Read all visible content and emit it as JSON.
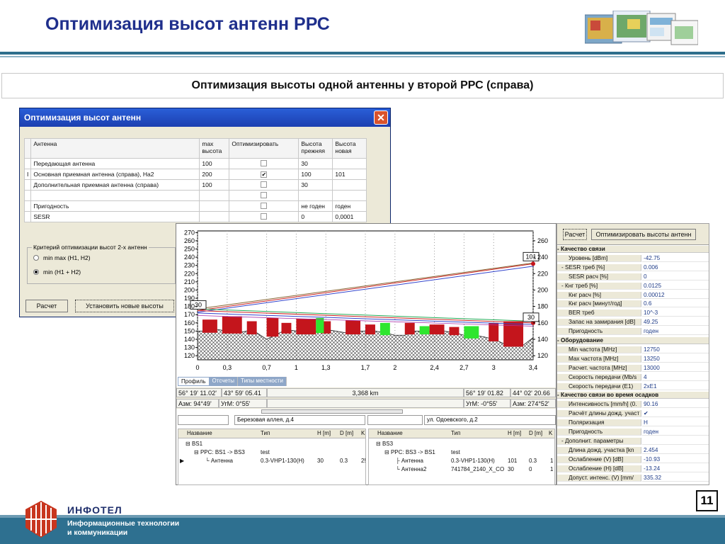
{
  "slide": {
    "title": "Оптимизация высот антенн РРС",
    "subtitle": "Оптимизация высоты одной антенны у второй РРС (справа)",
    "page_number": "11",
    "brand": "ИНФОТЕЛ",
    "tagline_1": "Информационные технологии",
    "tagline_2": "и коммуникации"
  },
  "dialog": {
    "title": "Оптимизация высот антенн",
    "close_icon": "close-icon",
    "headers": {
      "antenna": "Антенна",
      "max_height_1": "max",
      "max_height_2": "высота",
      "optimize": "Оптимизировать",
      "prev_1": "Высота",
      "prev_2": "прежняя",
      "new_1": "Высота",
      "new_2": "новая"
    },
    "rows": [
      {
        "marker": "",
        "name": "Передающая антенна",
        "max": "100",
        "checked": "",
        "prev": "30",
        "new": ""
      },
      {
        "marker": "I",
        "name": "Основная приемная антенна (справа), На2",
        "max": "200",
        "checked": "✔",
        "prev": "100",
        "new": "101"
      },
      {
        "marker": "",
        "name": "Дополнительная приемная антенна (справа)",
        "max": "100",
        "checked": "",
        "prev": "30",
        "new": ""
      },
      {
        "marker": "",
        "name": "",
        "max": "",
        "checked": "",
        "prev": "",
        "new": ""
      },
      {
        "marker": "",
        "name": "Пригодность",
        "max": "",
        "checked": "",
        "prev": "не годен",
        "new": "годен"
      },
      {
        "marker": "",
        "name": "SESR",
        "max": "",
        "checked": "",
        "prev": "0",
        "new": "0,0001"
      }
    ],
    "criterion_legend": "Критерий оптимизации высот 2-х антенн",
    "option_1": "min max (H1, H2)",
    "option_2": "min (H1 + H2)",
    "calc_button": "Расчет",
    "apply_button": "Установить новые высоты"
  },
  "profile": {
    "tabs": [
      "Профиль",
      "Отсчеты",
      "Типы местности"
    ],
    "left_coord": "56° 19' 11.02'",
    "left_coord_2": "43° 59' 05.41",
    "distance": "3,368 km",
    "right_coord": "56° 19' 01.82",
    "right_coord_2": "44° 02' 20.66",
    "az_left": "Азм: 94°49'",
    "ug_left": "УгМ: 0°55'",
    "ug_right": "УгМ: -0°55'",
    "az_right": "Азм: 274°52'",
    "site_left": "Березовая аллея, д.4",
    "site_right": "ул. Одоевского, д.2",
    "tree_headers": {
      "name": "Название",
      "type": "Тип",
      "h": "H [m]",
      "d": "D [m]",
      "k": "K"
    },
    "tree_left": [
      {
        "name": "BS1",
        "type": "",
        "h": "",
        "d": "",
        "k": ""
      },
      {
        "name": "PPC: BS1 -> BS3",
        "type": "test",
        "h": "",
        "d": "",
        "k": ""
      },
      {
        "name": "Антенна",
        "type": "0.3-VHP1-130(H)",
        "h": "30",
        "d": "0.3",
        "k": "2!"
      }
    ],
    "tree_right": [
      {
        "name": "BS3",
        "type": "",
        "h": "",
        "d": "",
        "k": ""
      },
      {
        "name": "PPC: BS3 -> BS1",
        "type": "test",
        "h": "",
        "d": "",
        "k": ""
      },
      {
        "name": "Антенна",
        "type": "0.3-VHP1-130(H)",
        "h": "101",
        "d": "0.3",
        "k": "1"
      },
      {
        "name": "Антенна2",
        "type": "741784_2140_X_CO",
        "h": "30",
        "d": "0",
        "k": "1"
      }
    ]
  },
  "chart_data": {
    "type": "line",
    "x_ticks": [
      "0",
      "0,3",
      "0,7",
      "1",
      "1,3",
      "1,7",
      "2",
      "2,4",
      "2,7",
      "3",
      "3,4"
    ],
    "y_left_ticks": [
      "270",
      "260",
      "250",
      "240",
      "230",
      "220",
      "210",
      "200",
      "190",
      "180",
      "170",
      "160",
      "150",
      "140",
      "130",
      "120"
    ],
    "y_right_ticks": [
      "260",
      "240",
      "220",
      "200",
      "180",
      "160",
      "140",
      "120"
    ],
    "xlim": [
      0,
      3.4
    ],
    "ylim": [
      115,
      272
    ],
    "antenna_labels": {
      "left": "30",
      "right_main": "101",
      "right_second": "30"
    },
    "left_tx_height": 175,
    "right_main_height": 232,
    "right_second_height": 160,
    "terrain_x": [
      0,
      0.1,
      0.2,
      0.3,
      0.4,
      0.5,
      0.6,
      0.7,
      0.8,
      0.9,
      1.0,
      1.1,
      1.2,
      1.3,
      1.4,
      1.5,
      1.6,
      1.7,
      1.8,
      1.9,
      2.0,
      2.1,
      2.2,
      2.3,
      2.4,
      2.5,
      2.6,
      2.7,
      2.8,
      2.9,
      3.0,
      3.1,
      3.2,
      3.3,
      3.4
    ],
    "terrain_y": [
      150,
      150,
      152,
      150,
      148,
      150,
      148,
      140,
      146,
      152,
      150,
      150,
      150,
      152,
      150,
      148,
      150,
      150,
      150,
      148,
      145,
      145,
      150,
      150,
      150,
      150,
      148,
      145,
      145,
      143,
      140,
      135,
      132,
      133,
      142
    ],
    "veg_red": [
      [
        0.05,
        0.2,
        164
      ],
      [
        0.25,
        0.45,
        168
      ],
      [
        0.5,
        0.6,
        162
      ],
      [
        0.7,
        0.82,
        166
      ],
      [
        0.85,
        0.95,
        160
      ],
      [
        1.0,
        1.2,
        165
      ],
      [
        1.25,
        1.35,
        162
      ],
      [
        1.5,
        1.65,
        163
      ],
      [
        1.7,
        1.8,
        158
      ],
      [
        2.1,
        2.2,
        160
      ],
      [
        2.35,
        2.5,
        158
      ],
      [
        2.55,
        2.65,
        155
      ],
      [
        2.95,
        3.05,
        160
      ],
      [
        3.1,
        3.3,
        162
      ]
    ],
    "veg_green": [
      [
        1.2,
        1.28,
        166
      ],
      [
        1.85,
        1.95,
        160
      ],
      [
        2.25,
        2.35,
        156
      ],
      [
        2.7,
        2.85,
        156
      ]
    ]
  },
  "props": {
    "calc_button": "Расчет",
    "optimize_button": "Оптимизировать высоты антенн",
    "rows": [
      {
        "h": "- Качество связи"
      },
      {
        "k": "Уровень [dBm]",
        "v": "-42.75"
      },
      {
        "k": "- SESR треб [%]",
        "v": "0.006"
      },
      {
        "k": "SESR расч [%]",
        "v": "0"
      },
      {
        "k": "- Кнг треб [%]",
        "v": "0.0125"
      },
      {
        "k": "Кнг расч [%]",
        "v": "0.00012"
      },
      {
        "k": "Кнг расч [минут/год]",
        "v": "0.6"
      },
      {
        "k": "BER треб",
        "v": "10^-3"
      },
      {
        "k": "Запас на замирания [dB]",
        "v": "49.25"
      },
      {
        "k": "Пригодность",
        "v": "годен"
      },
      {
        "h": "- Оборудование"
      },
      {
        "k": "Min частота [MHz]",
        "v": "12750"
      },
      {
        "k": "Max частота [MHz]",
        "v": "13250"
      },
      {
        "k": "Расчет. частота [MHz]",
        "v": "13000"
      },
      {
        "k": "Скорость передачи (Mb/s",
        "v": "4"
      },
      {
        "k": "Скорость передачи (E1)",
        "v": "2xE1"
      },
      {
        "h": "- Качество связи во время осадков"
      },
      {
        "k": "Интенсивность [mm/h] (0.",
        "v": "90.16"
      },
      {
        "k": "Расчёт длины дожд. участ",
        "v": "✔"
      },
      {
        "k": "Поляризация",
        "v": "H"
      },
      {
        "k": "Пригодность",
        "v": "годен"
      },
      {
        "k": "- Дополнит. параметры",
        "v": ""
      },
      {
        "k": "Длина дожд. участка [kn",
        "v": "2.454"
      },
      {
        "k": "Ослабление (V) [dB]",
        "v": "-10.93"
      },
      {
        "k": "Ослабление (H) [dB]",
        "v": "-13.24"
      },
      {
        "k": "Допуст. интенс. (V) [mm/",
        "v": "335.32"
      }
    ]
  }
}
